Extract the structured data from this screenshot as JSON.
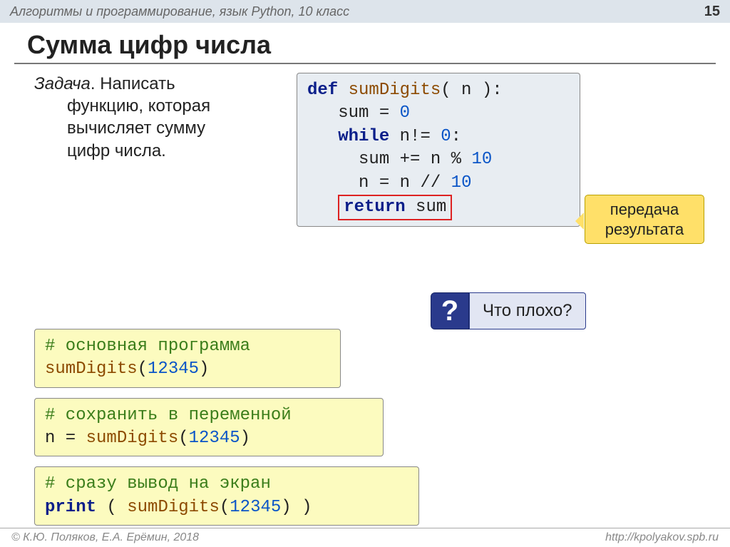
{
  "header": {
    "subject": "Алгоритмы и программирование, язык Python, 10 класс",
    "page": "15"
  },
  "title": "Сумма цифр числа",
  "task": {
    "label": "Задача",
    "text1": ". Написать",
    "text2": "функцию, которая",
    "text3": "вычисляет сумму",
    "text4": "цифр числа."
  },
  "code": {
    "kw_def": "def",
    "fn": "sumDigits",
    "sig_rest": "( n ):",
    "l2a": "sum",
    "l2b": "=",
    "l2c": "0",
    "kw_while": "while",
    "l3a": "n!=",
    "l3zero": "0",
    "l3colon": ":",
    "l4a": "sum",
    "l4b": "+=",
    "l4c": "n",
    "l4d": "%",
    "l4ten": "10",
    "l5a": "n",
    "l5b": "=",
    "l5c": "n",
    "l5d": "//",
    "l5ten": "10",
    "kw_return": "return",
    "ret_var": "sum"
  },
  "callout": {
    "line1": "передача",
    "line2": "результата"
  },
  "ybox1": {
    "comment": "# основная программа",
    "fn": "sumDigits",
    "open": "(",
    "num": "12345",
    "close": ")"
  },
  "ybox2": {
    "comment": "# сохранить в переменной",
    "pre": "n = ",
    "fn": "sumDigits",
    "open": "(",
    "num": "12345",
    "close": ")"
  },
  "ybox3": {
    "comment": "# сразу вывод на экран",
    "kw_print": "print",
    "open1": " ( ",
    "fn": "sumDigits",
    "open2": "(",
    "num": "12345",
    "close": ") )"
  },
  "question": {
    "icon": "?",
    "text": "Что плохо?"
  },
  "footer": {
    "left": "© К.Ю. Поляков, Е.А. Ерёмин, 2018",
    "right": "http://kpolyakov.spb.ru"
  }
}
